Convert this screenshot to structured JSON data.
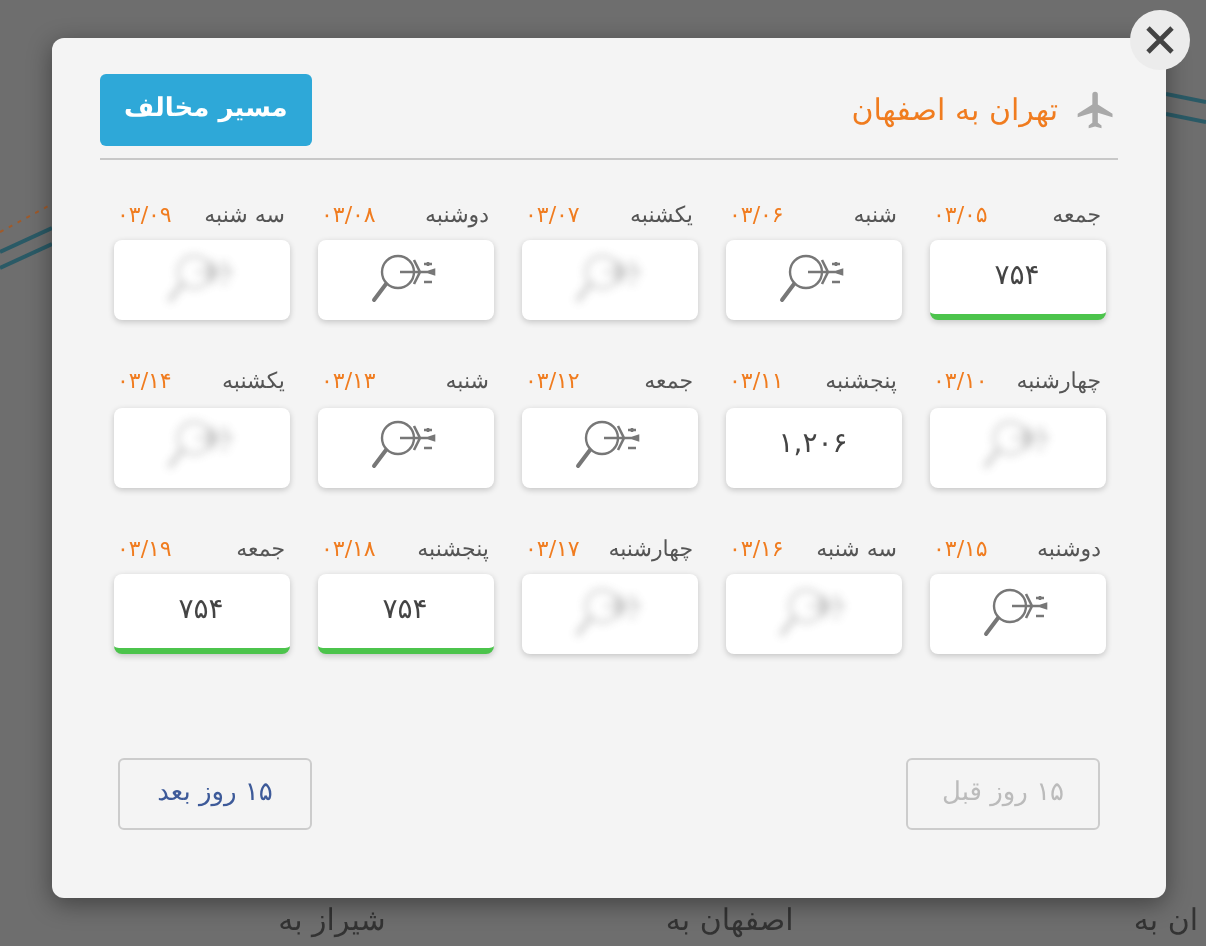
{
  "modal": {
    "title": "تهران به اصفهان",
    "reverse_button": "مسیر مخالف",
    "days": [
      {
        "day": "جمعه",
        "date": "۰۳/۰۵",
        "kind": "price",
        "price": "۷۵۴",
        "highlight": true
      },
      {
        "day": "شنبه",
        "date": "۰۳/۰۶",
        "kind": "search"
      },
      {
        "day": "یکشنبه",
        "date": "۰۳/۰۷",
        "kind": "none"
      },
      {
        "day": "دوشنبه",
        "date": "۰۳/۰۸",
        "kind": "search"
      },
      {
        "day": "سه شنبه",
        "date": "۰۳/۰۹",
        "kind": "none"
      },
      {
        "day": "چهارشنبه",
        "date": "۰۳/۱۰",
        "kind": "none"
      },
      {
        "day": "پنجشنبه",
        "date": "۰۳/۱۱",
        "kind": "price",
        "price": "۱,۲۰۶",
        "highlight": false
      },
      {
        "day": "جمعه",
        "date": "۰۳/۱۲",
        "kind": "search"
      },
      {
        "day": "شنبه",
        "date": "۰۳/۱۳",
        "kind": "search"
      },
      {
        "day": "یکشنبه",
        "date": "۰۳/۱۴",
        "kind": "none"
      },
      {
        "day": "دوشنبه",
        "date": "۰۳/۱۵",
        "kind": "search"
      },
      {
        "day": "سه شنبه",
        "date": "۰۳/۱۶",
        "kind": "none"
      },
      {
        "day": "چهارشنبه",
        "date": "۰۳/۱۷",
        "kind": "none"
      },
      {
        "day": "پنجشنبه",
        "date": "۰۳/۱۸",
        "kind": "price",
        "price": "۷۵۴",
        "highlight": true
      },
      {
        "day": "جمعه",
        "date": "۰۳/۱۹",
        "kind": "price",
        "price": "۷۵۴",
        "highlight": true
      }
    ],
    "prev_button": {
      "label": "۱۵ روز قبل",
      "disabled": true
    },
    "next_button": {
      "label": "۱۵ روز بعد",
      "disabled": false
    }
  },
  "background": {
    "bottom_texts": [
      "ان به",
      "اصفهان به",
      "شیراز به"
    ]
  }
}
